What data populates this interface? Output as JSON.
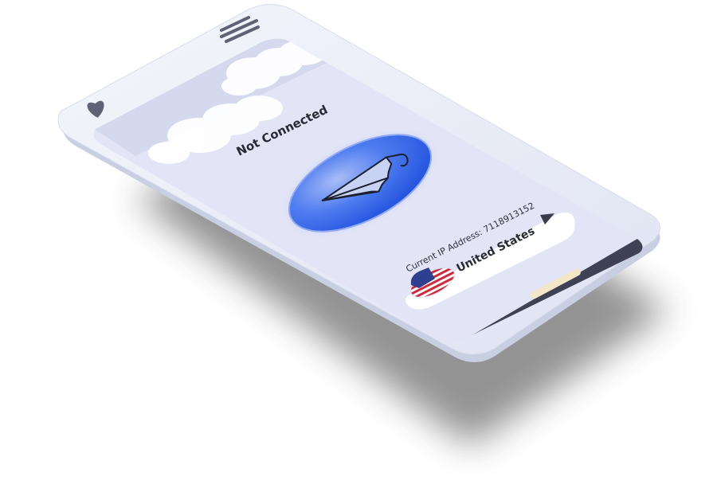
{
  "app": {
    "status": "Not Connected",
    "ip_address_label": "Current IP Address: 7118913152",
    "location": {
      "country": "United States",
      "flag": "us-flag-icon"
    },
    "connect_button_icon": "umbrella-icon",
    "header_icons": [
      "heart-icon",
      "menu-icon"
    ]
  },
  "colors": {
    "screen_background": "#e3e5f6",
    "connect_button": "#2d63e6",
    "phone_frame": "#edf0f8",
    "bottom_bar": "#3e4254"
  }
}
